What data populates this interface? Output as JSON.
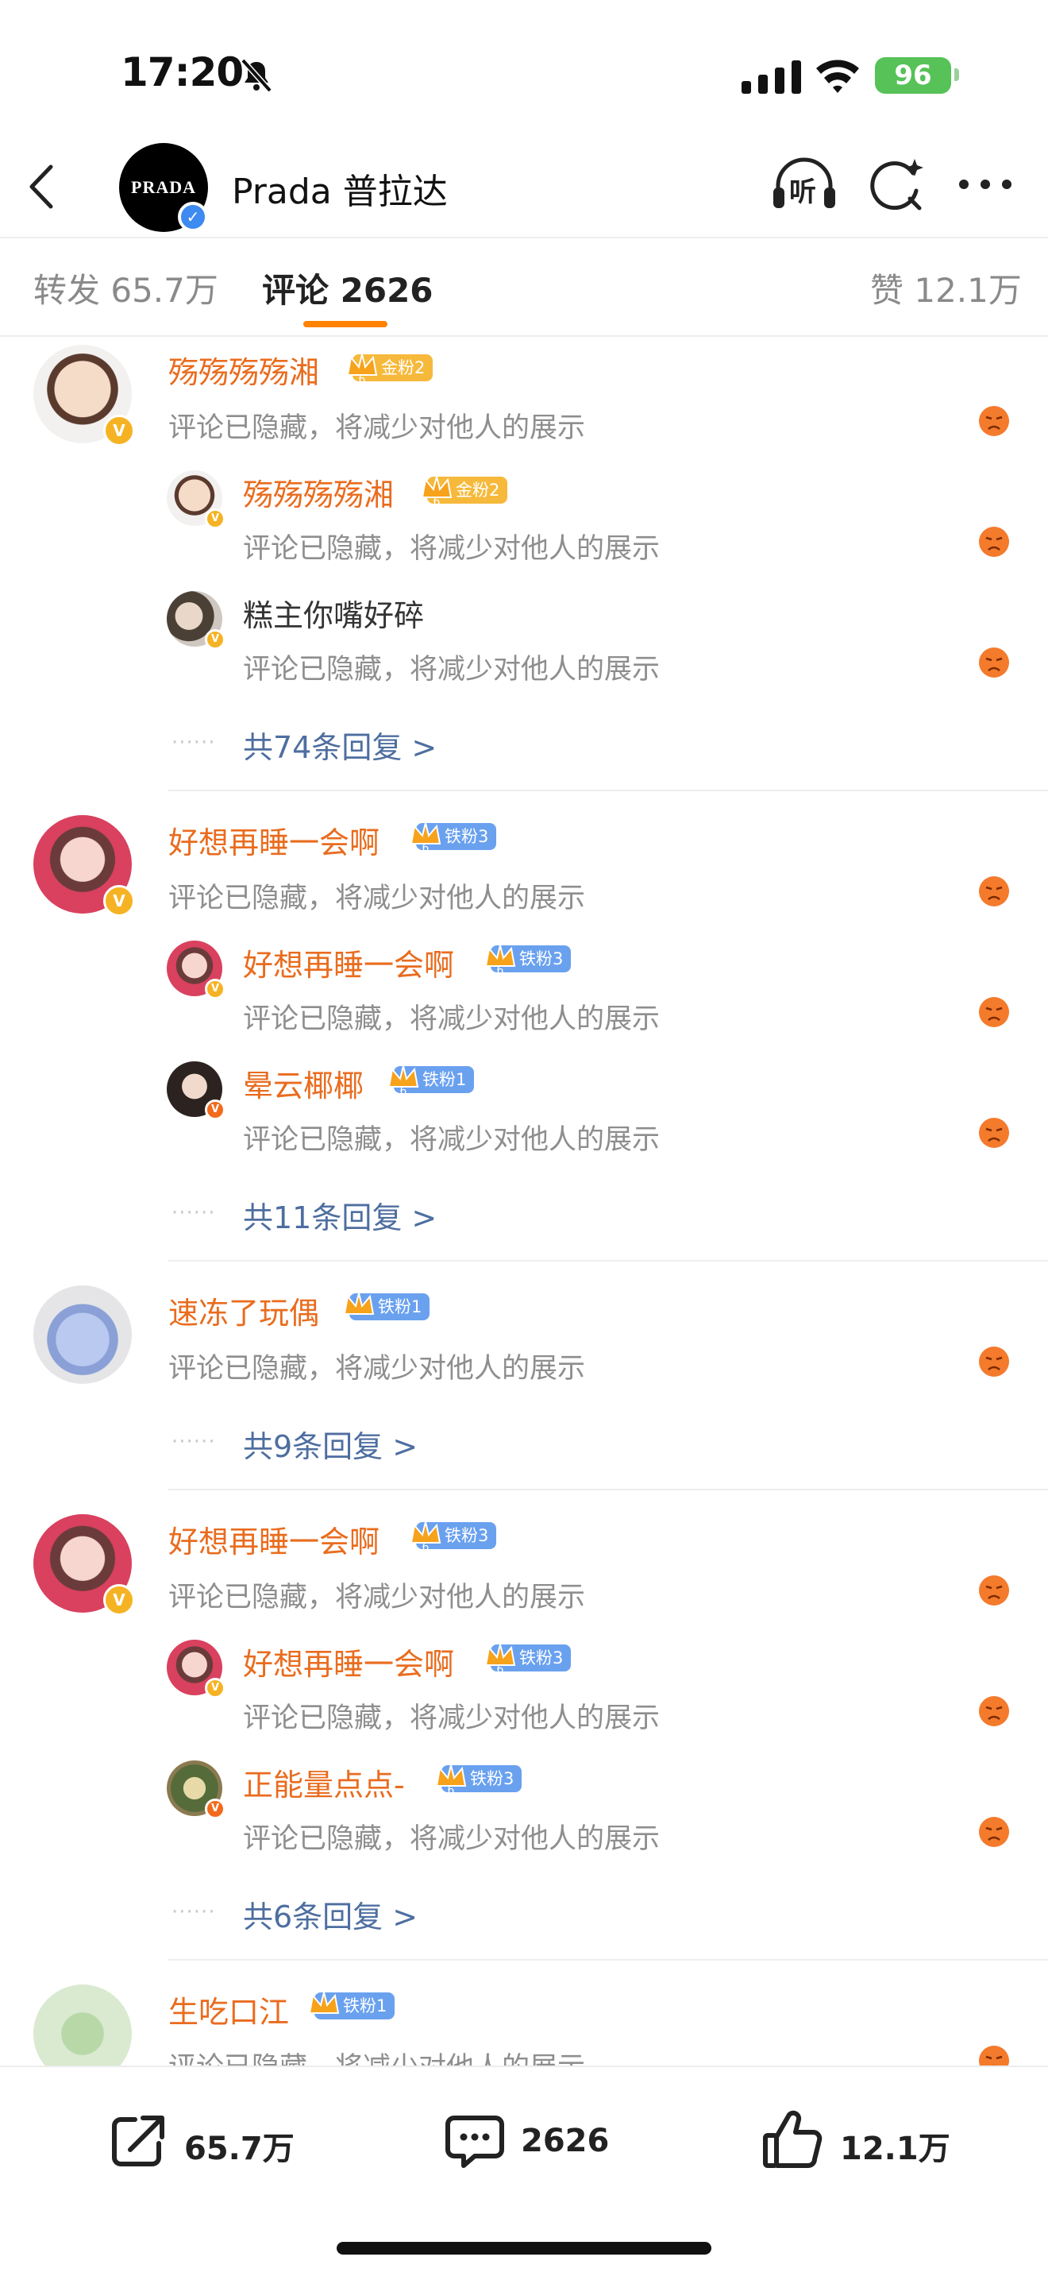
{
  "status_bar": {
    "time": "17:20",
    "battery": "96"
  },
  "header": {
    "title": "Prada 普拉达",
    "logo_text": "PRADA",
    "listen_label": "听"
  },
  "tabs": [
    {
      "label": "转发 65.7万"
    },
    {
      "label": "评论 2626",
      "active": true
    },
    {
      "label": "赞 12.1万"
    }
  ],
  "hidden_text": "评论已隐藏，将减少对他人的展示",
  "threads": [
    {
      "user": "殇殇殇殇湘",
      "badge": "金粉2",
      "badge_type": "gold",
      "badge_level": "6",
      "replies": [
        {
          "user": "殇殇殇殇湘",
          "badge": "金粉2",
          "badge_type": "gold",
          "badge_level": "6"
        },
        {
          "user": "糕主你嘴好碎",
          "badge": "",
          "badge_type": "none",
          "badge_level": ""
        }
      ],
      "more_dots": "······",
      "more_label": "共74条回复 >"
    },
    {
      "user": "好想再睡一会啊",
      "badge": "铁粉3",
      "badge_type": "iron",
      "badge_level": "6",
      "replies": [
        {
          "user": "好想再睡一会啊",
          "badge": "铁粉3",
          "badge_type": "iron",
          "badge_level": "6"
        },
        {
          "user": "晕云椰椰",
          "badge": "铁粉1",
          "badge_type": "iron",
          "badge_level": "6"
        }
      ],
      "more_dots": "······",
      "more_label": "共11条回复 >"
    },
    {
      "user": "速冻了玩偶",
      "badge": "铁粉1",
      "badge_type": "iron",
      "badge_level": "",
      "replies": [],
      "more_dots": "······",
      "more_label": "共9条回复 >"
    },
    {
      "user": "好想再睡一会啊",
      "badge": "铁粉3",
      "badge_type": "iron",
      "badge_level": "6",
      "replies": [
        {
          "user": "好想再睡一会啊",
          "badge": "铁粉3",
          "badge_type": "iron",
          "badge_level": "6"
        },
        {
          "user": "正能量点点-",
          "badge": "铁粉3",
          "badge_type": "iron",
          "badge_level": "6"
        }
      ],
      "more_dots": "······",
      "more_label": "共6条回复 >"
    },
    {
      "user": "生吃口江",
      "badge": "铁粉1",
      "badge_type": "iron",
      "badge_level": "",
      "replies": []
    }
  ],
  "bottom_bar": {
    "repost": "65.7万",
    "comment": "2626",
    "like": "12.1万"
  },
  "colors": {
    "accent": "#ff8200",
    "username": "#e96c1e",
    "link": "#4e6ea0",
    "gold_badge": "#f6b93b",
    "iron_badge": "#6aa1ef"
  }
}
